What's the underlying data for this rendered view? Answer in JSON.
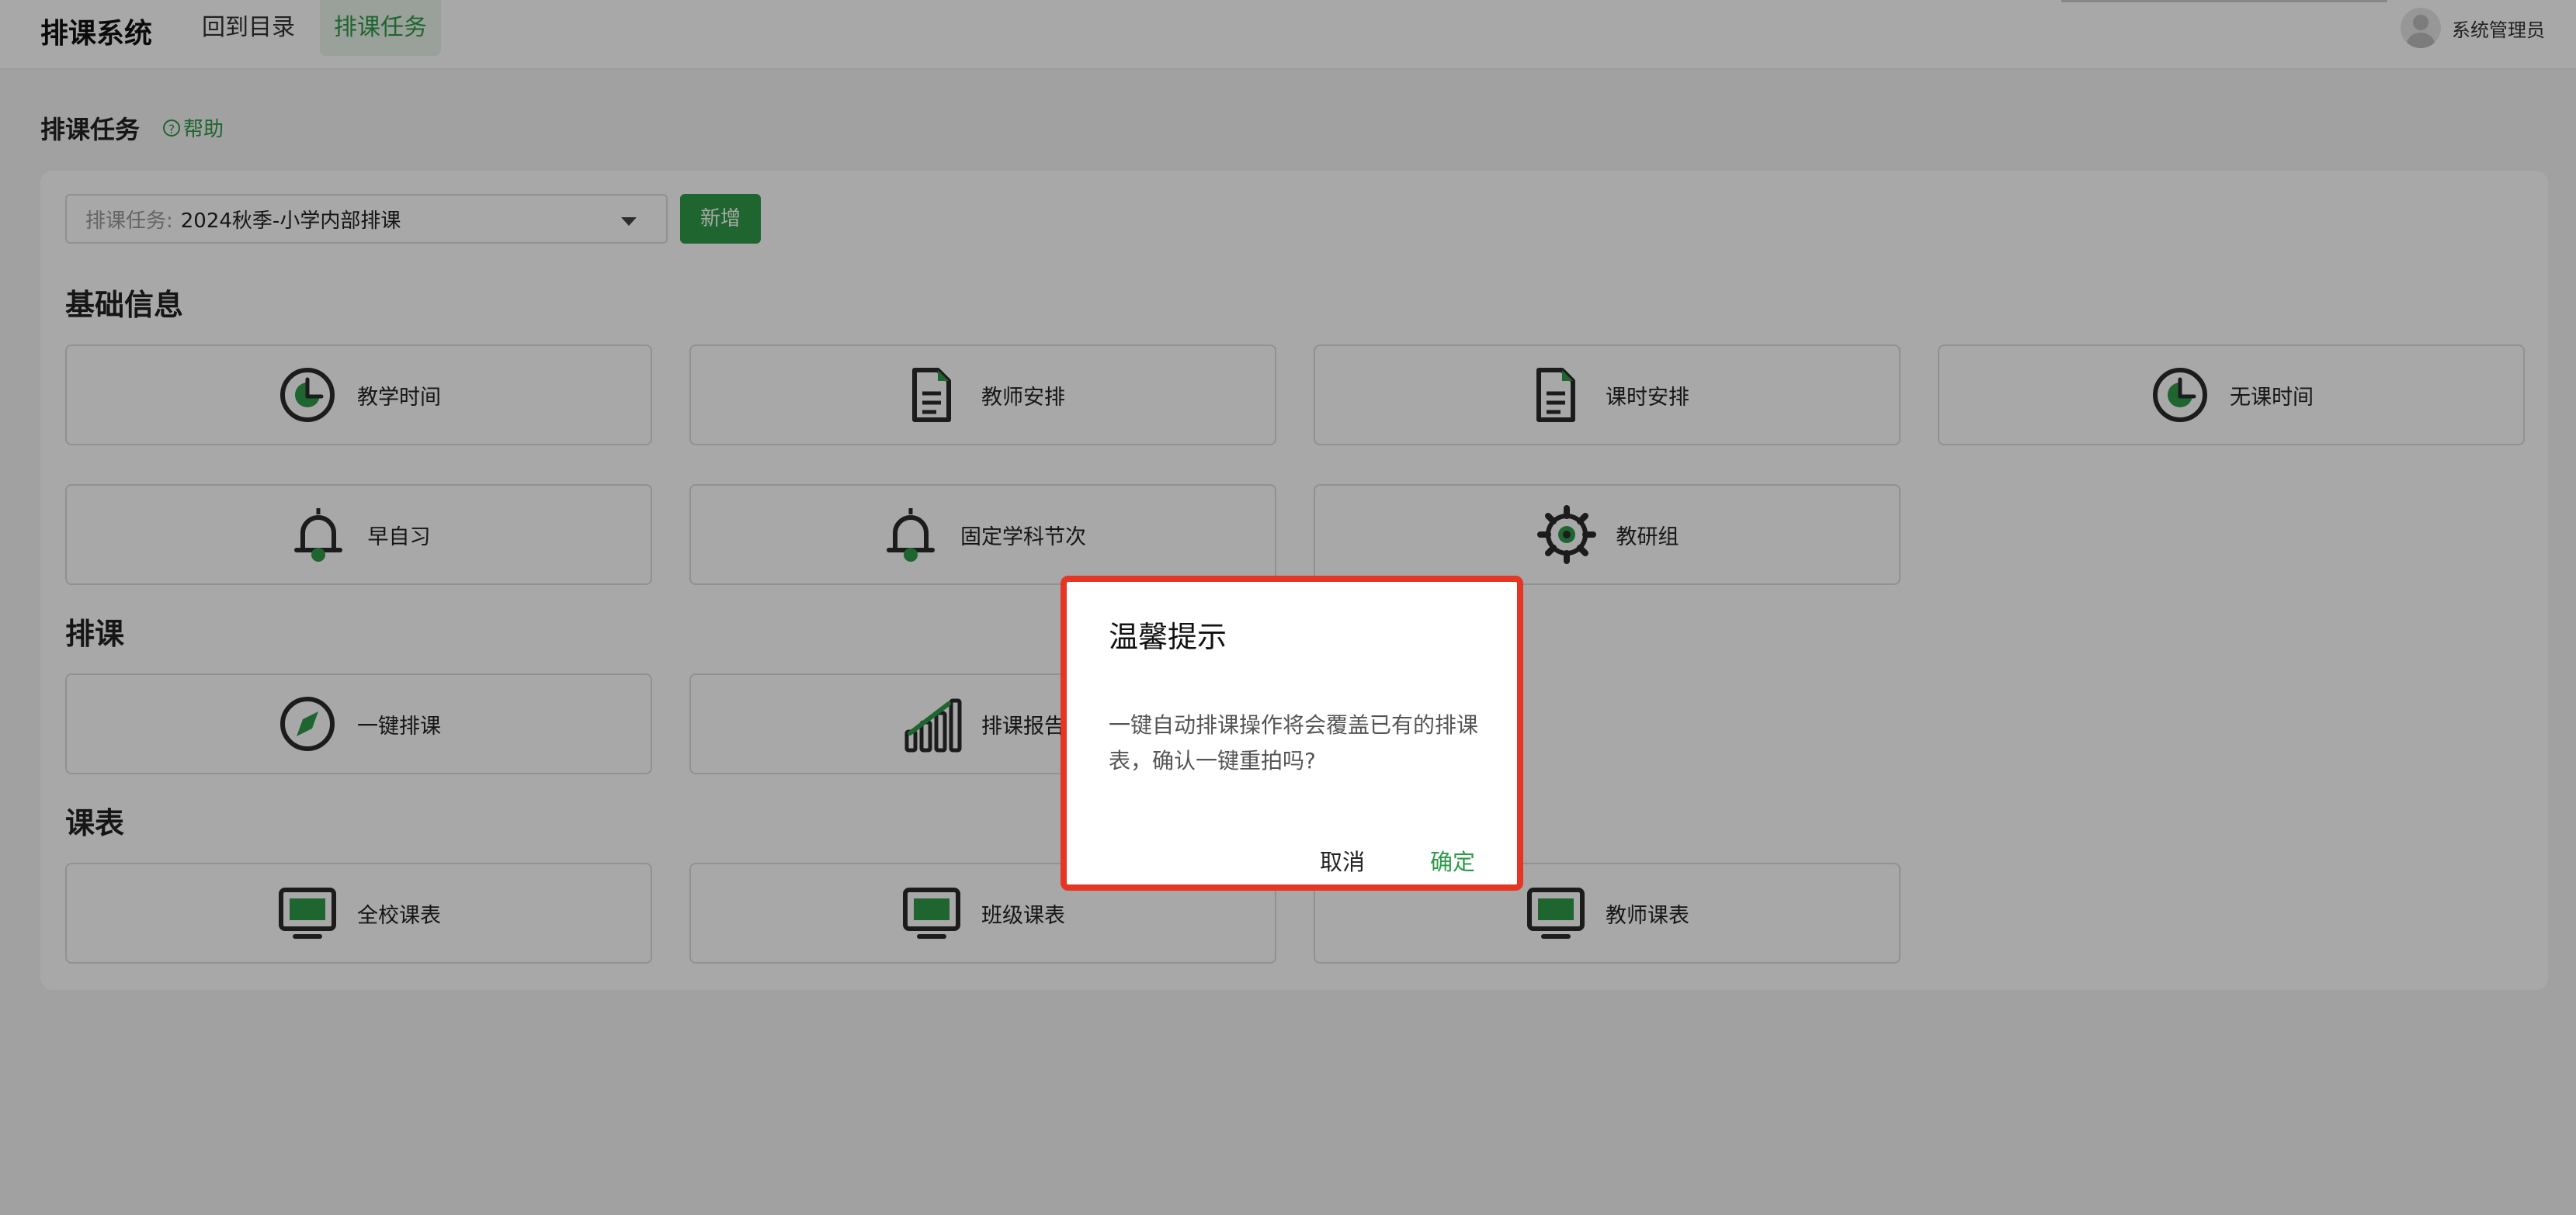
{
  "header": {
    "brand": "排课系统",
    "nav_back": "回到目录",
    "nav_task": "排课任务",
    "user_name": "系统管理员"
  },
  "page": {
    "title": "排课任务",
    "help": "帮助",
    "select_prefix": "排课任务:",
    "select_value": "2024秋季-小学内部排课",
    "add_label": "新增"
  },
  "sections": {
    "basic": "基础信息",
    "schedule": "排课",
    "timetable": "课表"
  },
  "cards": {
    "teaching_time": "教学时间",
    "teacher_arrangement": "教师安排",
    "lesson_arrangement": "课时安排",
    "no_class_time": "无课时间",
    "morning_study": "早自习",
    "fixed_subject_periods": "固定学科节次",
    "research_group": "教研组",
    "one_click_schedule": "一键排课",
    "schedule_report": "排课报告",
    "school_timetable": "全校课表",
    "class_timetable": "班级课表",
    "teacher_timetable": "教师课表"
  },
  "dialog": {
    "title": "温馨提示",
    "message": "一键自动排课操作将会覆盖已有的排课表，确认一键重拍吗?",
    "cancel": "取消",
    "confirm": "确定"
  },
  "colors": {
    "accent": "#2e9a48",
    "highlight_border": "#e53524"
  }
}
